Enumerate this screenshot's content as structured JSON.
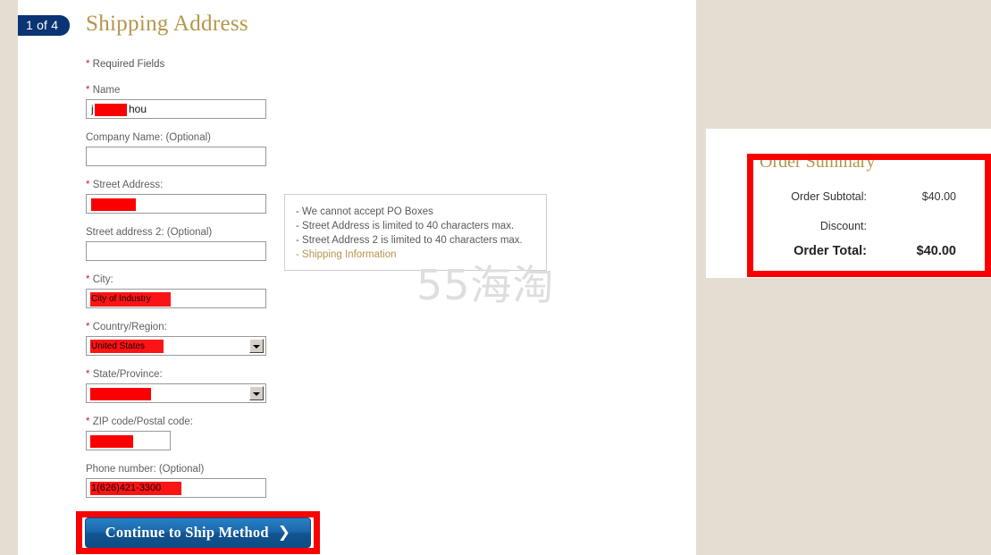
{
  "header": {
    "step_badge": "1 of 4",
    "title": "Shipping Address"
  },
  "form": {
    "required_note_star": "*",
    "required_note": " Required Fields",
    "fields": [
      {
        "label": "Name",
        "required": true,
        "value": "j███hou",
        "redacted": true
      },
      {
        "label": "Company Name: (Optional)",
        "required": false,
        "value": "",
        "redacted": false
      },
      {
        "label": "Street Address:",
        "required": true,
        "value": "",
        "redacted": true
      },
      {
        "label": "Street address 2: (Optional)",
        "required": false,
        "value": "",
        "redacted": false
      },
      {
        "label": "City:",
        "required": true,
        "value": "City of Industry",
        "redacted": true
      },
      {
        "label": "Country/Region:",
        "required": true,
        "value": "United States",
        "redacted": true
      },
      {
        "label": "State/Province:",
        "required": true,
        "value": "",
        "redacted": true
      },
      {
        "label": "ZIP code/Postal code:",
        "required": true,
        "value": "",
        "redacted": true
      },
      {
        "label": "Phone number: (Optional)",
        "required": false,
        "value": "1(626)421-3300",
        "redacted": true
      }
    ],
    "submit_label": "Continue to Ship Method",
    "submit_chevron": "❯"
  },
  "info_box": {
    "lines": [
      "- We cannot accept PO Boxes",
      "- Street Address is limited to 40 characters max.",
      "- Street Address 2 is limited to 40 characters max."
    ],
    "link": "- Shipping Information"
  },
  "watermark": "55海淘",
  "order_summary": {
    "title": "Order Summary",
    "rows": [
      {
        "label": "Order Subtotal:",
        "amount": "$40.00"
      },
      {
        "label": "Discount:",
        "amount": ""
      },
      {
        "label": "Order Total:",
        "amount": "$40.00"
      }
    ]
  },
  "colors": {
    "badge_navy": "#0a3473",
    "title_gold": "#b5954a",
    "annotation_red": "#fb0000",
    "button_blue": "#1a69ad",
    "rail_beige": "#e5ddd2"
  }
}
